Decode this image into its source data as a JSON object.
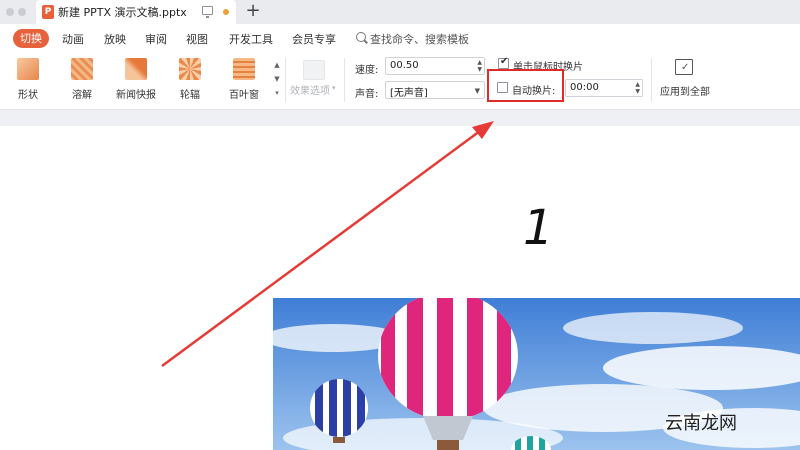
{
  "titlebar": {
    "doc_title": "新建 PPTX 演示文稿.pptx",
    "doc_icon_letter": "P",
    "new_tab": "+"
  },
  "menu": {
    "active": "切换",
    "items": [
      "动画",
      "放映",
      "审阅",
      "视图",
      "开发工具",
      "会员专享"
    ],
    "search_placeholder": "查找命令、搜索模板"
  },
  "ribbon": {
    "effects": [
      {
        "label": "形状",
        "color": "#f0a46a"
      },
      {
        "label": "溶解",
        "color": "#f2b27a"
      },
      {
        "label": "新闻快报",
        "color": "#ee9a5a"
      },
      {
        "label": "轮辐",
        "color": "#f5b98a"
      },
      {
        "label": "百叶窗",
        "color": "#ec8f4e"
      }
    ],
    "effect_options_label": "效果选项",
    "speed_label": "速度:",
    "speed_value": "00.50",
    "sound_label": "声音:",
    "sound_value": "[无声音]",
    "on_click_label": "单击鼠标时换片",
    "on_click_checked": true,
    "auto_advance_label": "自动换片:",
    "auto_advance_checked": false,
    "auto_advance_time": "00:00",
    "apply_all_label": "应用到全部"
  },
  "slide": {
    "number_text": "1",
    "watermark": "云南龙网"
  },
  "colors": {
    "accent": "#e8613d",
    "highlight": "#e02b2b",
    "arrow": "#e53a35"
  }
}
